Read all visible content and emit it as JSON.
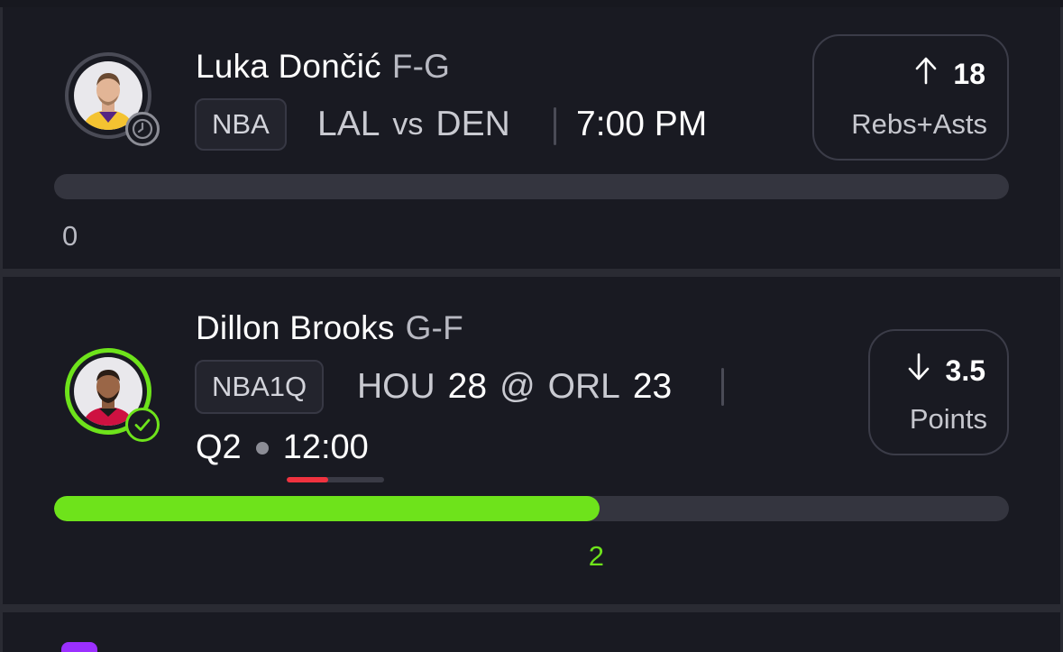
{
  "cards": [
    {
      "player_name": "Luka Dončić",
      "position": "F-G",
      "league": "NBA",
      "matchup": {
        "team_a": "LAL",
        "connector": "vs",
        "team_b": "DEN"
      },
      "game_time": "7:00 PM",
      "pick": {
        "direction": "over",
        "line": "18",
        "stat": "Rebs+Asts"
      },
      "progress": {
        "current": "0",
        "fraction": 0
      },
      "avatar_badge_icon": "clock-icon",
      "colors": {
        "ring": "#4a4b56",
        "badge": "#8c8d96"
      }
    },
    {
      "player_name": "Dillon Brooks",
      "position": "G-F",
      "league": "NBA1Q",
      "matchup": {
        "team_a": "HOU",
        "score_a": "28",
        "connector": "@",
        "team_b": "ORL",
        "score_b": "23"
      },
      "quarter": "Q2",
      "clock": "12:00",
      "clock_elapsed_fraction": 0.43,
      "pick": {
        "direction": "under",
        "line": "3.5",
        "stat": "Points"
      },
      "progress": {
        "current": "2",
        "fraction": 0.571
      },
      "avatar_badge_icon": "check-icon",
      "colors": {
        "ring": "#6ee31b",
        "fill": "#6ee31b",
        "clock_bar": "#f0323f"
      }
    }
  ],
  "icons": {
    "over": "arrow-up-icon",
    "under": "arrow-down-icon"
  },
  "colors": {
    "background": "#191a22",
    "accent_green": "#6ee31b",
    "brand_purple": "#9b30ff"
  }
}
